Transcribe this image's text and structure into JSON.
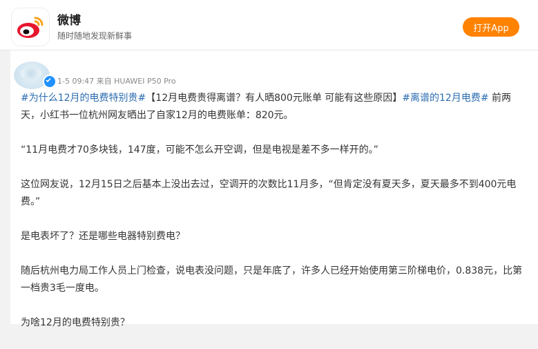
{
  "header": {
    "app_name": "微博",
    "slogan": "随时随地发现新鲜事",
    "open_button": "打开App",
    "logo_icon": "weibo-logo-icon",
    "brand_color": "#ff8200"
  },
  "post": {
    "meta": "1-5 09:47  来自 HUAWEI P50 Pro",
    "verified_icon": "verified-badge-icon",
    "topic_color": "#2b6cb0",
    "intro_topic1": "#为什么12月的电费特别贵#",
    "intro_text1": "【12月电费贵得离谱？有人晒800元账单 可能有这些原因】",
    "intro_topic2": "#离谱的12月电费#",
    "intro_text2": " 前两天，小红书一位杭州网友晒出了自家12月的电费账单：820元。",
    "p2": "“11月电费才70多块钱，147度，可能不怎么开空调，但是电视是差不多一样开的。”",
    "p3": "这位网友说，12月15日之后基本上没出去过，空调开的次数比11月多，“但肯定没有夏天多，夏天最多不到400元电费。”",
    "p4": "是电表坏了？还是哪些电器特别费电？",
    "p5": "随后杭州电力局工作人员上门检查，说电表没问题，只是年底了，许多人已经开始使用第三阶梯电价，0.838元，比第一档贵3毛一度电。",
    "p6": "为啥12月的电费特别贵？"
  }
}
